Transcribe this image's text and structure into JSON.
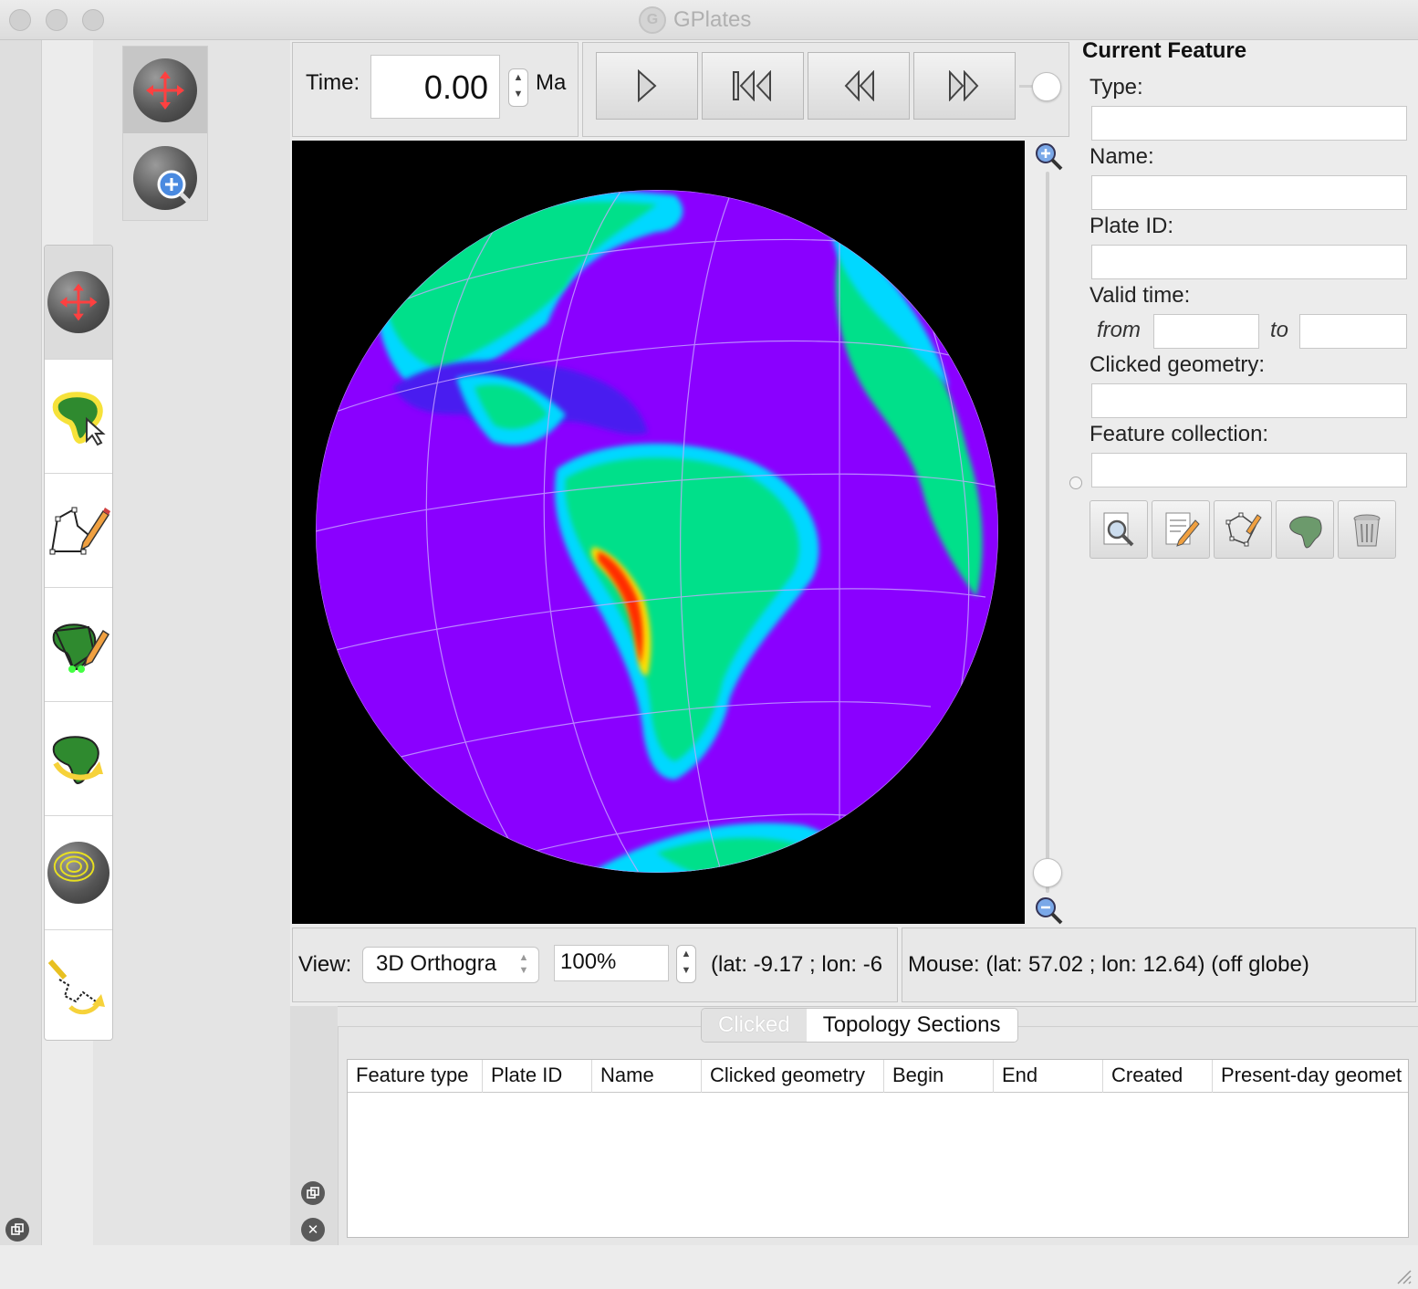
{
  "window": {
    "title": "GPlates"
  },
  "time_control": {
    "label": "Time:",
    "value": "0.00",
    "unit": "Ma"
  },
  "animation": {
    "buttons": [
      "play-icon",
      "reset-icon",
      "step-back-icon",
      "step-forward-icon"
    ]
  },
  "view_bar": {
    "view_label": "View:",
    "projection": "3D Orthogra",
    "zoom": "100%",
    "camera_coords": "(lat: -9.17 ; lon: -6"
  },
  "mouse_bar": {
    "text": "Mouse: (lat: 57.02 ; lon: 12.64) (off globe)"
  },
  "current_feature": {
    "title": "Current Feature",
    "type_label": "Type:",
    "name_label": "Name:",
    "plate_id_label": "Plate ID:",
    "valid_time_label": "Valid time:",
    "from_label": "from",
    "to_label": "to",
    "clicked_geometry_label": "Clicked geometry:",
    "feature_collection_label": "Feature collection:",
    "values": {
      "type": "",
      "name": "",
      "plate_id": "",
      "from": "",
      "to": "",
      "clicked_geometry": "",
      "feature_collection": ""
    }
  },
  "tabs": [
    {
      "label": "Clicked",
      "active": false
    },
    {
      "label": "Topology Sections",
      "active": true
    }
  ],
  "table": {
    "columns": [
      "Feature type",
      "Plate ID",
      "Name",
      "Clicked geometry",
      "Begin",
      "End",
      "Created",
      "Present-day geomet"
    ]
  },
  "colors": {
    "ocean": "#8a00ff",
    "deep_ocean": "#4a1cf0",
    "shelf": "#00c8ff",
    "lowland": "#00e888",
    "highland": "#ff2a00",
    "background": "#000000"
  }
}
